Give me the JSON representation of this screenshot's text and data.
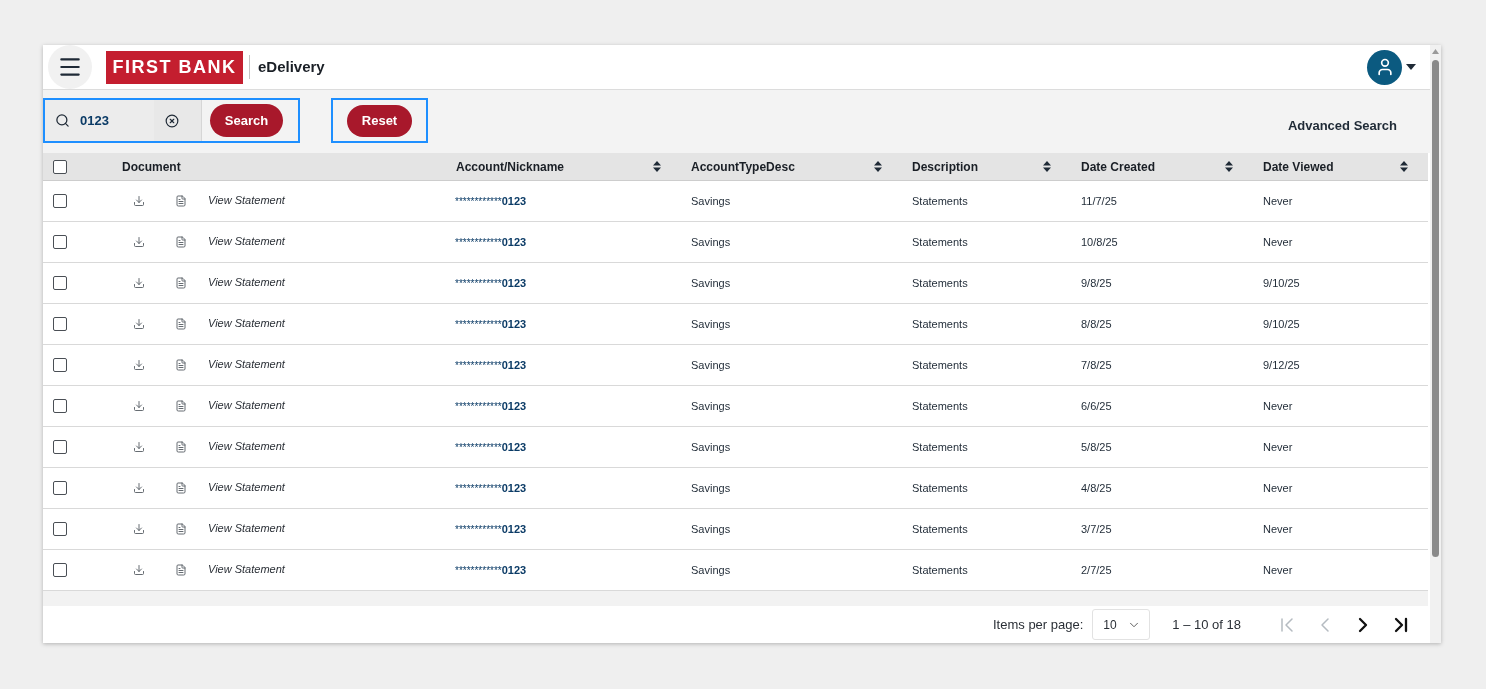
{
  "header": {
    "logo": "FIRST BANK",
    "app_name": "eDelivery"
  },
  "toolbar": {
    "search": {
      "value": "0123",
      "button": "Search"
    },
    "reset_button": "Reset",
    "advanced_search": "Advanced Search"
  },
  "table": {
    "select_all": {
      "checked": false
    },
    "columns": [
      {
        "label": "Document",
        "sortable": false
      },
      {
        "label": "Account/Nickname",
        "sortable": true
      },
      {
        "label": "AccountTypeDesc",
        "sortable": true
      },
      {
        "label": "Description",
        "sortable": true
      },
      {
        "label": "Date Created",
        "sortable": true
      },
      {
        "label": "Date Viewed",
        "sortable": true
      }
    ],
    "rows": [
      {
        "checked": false,
        "document": "View Statement",
        "account_mask": "************",
        "account_suffix": "0123",
        "account_type": "Savings",
        "description": "Statements",
        "date_created": "11/7/25",
        "date_viewed": "Never"
      },
      {
        "checked": false,
        "document": "View Statement",
        "account_mask": "************",
        "account_suffix": "0123",
        "account_type": "Savings",
        "description": "Statements",
        "date_created": "10/8/25",
        "date_viewed": "Never"
      },
      {
        "checked": false,
        "document": "View Statement",
        "account_mask": "************",
        "account_suffix": "0123",
        "account_type": "Savings",
        "description": "Statements",
        "date_created": "9/8/25",
        "date_viewed": "9/10/25"
      },
      {
        "checked": false,
        "document": "View Statement",
        "account_mask": "************",
        "account_suffix": "0123",
        "account_type": "Savings",
        "description": "Statements",
        "date_created": "8/8/25",
        "date_viewed": "9/10/25"
      },
      {
        "checked": false,
        "document": "View Statement",
        "account_mask": "************",
        "account_suffix": "0123",
        "account_type": "Savings",
        "description": "Statements",
        "date_created": "7/8/25",
        "date_viewed": "9/12/25"
      },
      {
        "checked": false,
        "document": "View Statement",
        "account_mask": "************",
        "account_suffix": "0123",
        "account_type": "Savings",
        "description": "Statements",
        "date_created": "6/6/25",
        "date_viewed": "Never"
      },
      {
        "checked": false,
        "document": "View Statement",
        "account_mask": "************",
        "account_suffix": "0123",
        "account_type": "Savings",
        "description": "Statements",
        "date_created": "5/8/25",
        "date_viewed": "Never"
      },
      {
        "checked": false,
        "document": "View Statement",
        "account_mask": "************",
        "account_suffix": "0123",
        "account_type": "Savings",
        "description": "Statements",
        "date_created": "4/8/25",
        "date_viewed": "Never"
      },
      {
        "checked": false,
        "document": "View Statement",
        "account_mask": "************",
        "account_suffix": "0123",
        "account_type": "Savings",
        "description": "Statements",
        "date_created": "3/7/25",
        "date_viewed": "Never"
      },
      {
        "checked": false,
        "document": "View Statement",
        "account_mask": "************",
        "account_suffix": "0123",
        "account_type": "Savings",
        "description": "Statements",
        "date_created": "2/7/25",
        "date_viewed": "Never"
      }
    ]
  },
  "pagination": {
    "label": "Items per page:",
    "page_size": "10",
    "range": "1 – 10 of 18",
    "first_disabled": true,
    "prev_disabled": true,
    "next_disabled": false,
    "last_disabled": false
  }
}
